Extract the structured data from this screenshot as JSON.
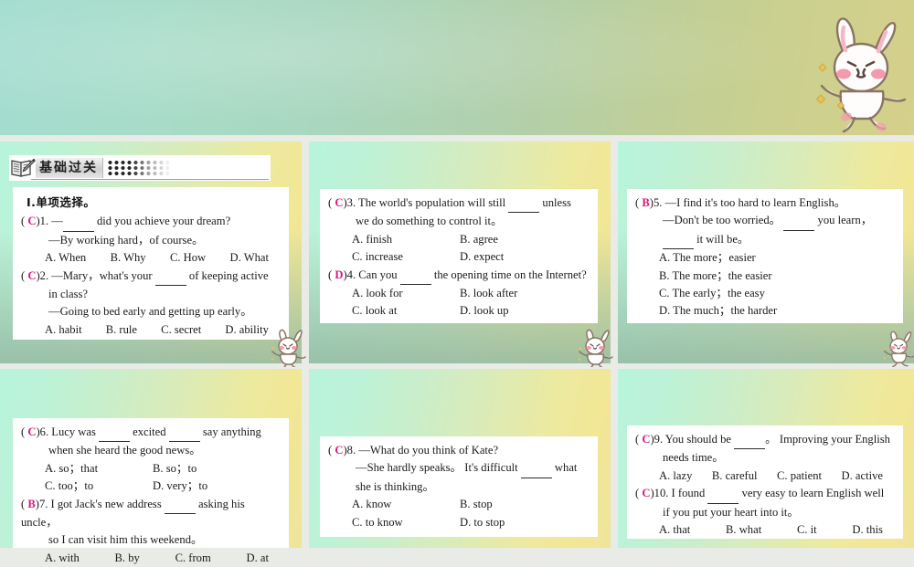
{
  "header": {
    "section_label": "基础过关",
    "book_icon": "open-book-with-pen-icon"
  },
  "subtitle": "Ⅰ.单项选择。",
  "mascot": "cartoon-rabbit-mascot",
  "colors": {
    "answer_pink": "#d6197d",
    "banner_teal": "#a3ddd0",
    "banner_olive": "#d5d08b",
    "card_white": "#ffffff",
    "slide_mint": "#b7f4dd",
    "slide_yellow": "#f2e795"
  },
  "questions": [
    {
      "number": "1.",
      "answer": "C",
      "mark_open": "(",
      "mark_close": ")",
      "lines": [
        {
          "indent": 0,
          "text": "—______ did you achieve your dream?"
        },
        {
          "indent": 1,
          "text": "—By working hard，of course。"
        }
      ],
      "options_layout": "row4",
      "options": [
        "A. When",
        "B. Why",
        "C. How",
        "D. What"
      ]
    },
    {
      "number": "2.",
      "answer": "C",
      "mark_open": "(",
      "mark_close": ")",
      "lines": [
        {
          "indent": 0,
          "text": "—Mary，what's your ______ of keeping active"
        },
        {
          "indent": 1,
          "text": "in class?"
        },
        {
          "indent": 1,
          "text": "—Going to bed early and getting up early。"
        }
      ],
      "options_layout": "row4",
      "options": [
        "A. habit",
        "B. rule",
        "C. secret",
        "D. ability"
      ]
    },
    {
      "number": "3.",
      "answer": "C",
      "mark_open": "(",
      "mark_close": ")",
      "lines": [
        {
          "indent": 0,
          "text": "The world's population will still ______ unless"
        },
        {
          "indent": 1,
          "text": "we do something to control it。"
        }
      ],
      "options_layout": "grid2",
      "options": [
        "A. finish",
        "B. agree",
        "C. increase",
        "D. expect"
      ]
    },
    {
      "number": "4.",
      "answer": "D",
      "mark_open": "(",
      "mark_close": ")",
      "lines": [
        {
          "indent": 0,
          "text": "Can you ______ the opening time on the Internet?"
        }
      ],
      "options_layout": "grid2",
      "options": [
        "A. look for",
        "B. look after",
        "C. look at",
        "D. look up"
      ]
    },
    {
      "number": "5.",
      "answer": "B",
      "mark_open": "(",
      "mark_close": ")",
      "lines": [
        {
          "indent": 0,
          "text": "—I find it's too hard to learn English。"
        },
        {
          "indent": 1,
          "text": "—Don't be too worried。 ______ you learn，"
        },
        {
          "indent": 1,
          "text": "______ it will be。"
        }
      ],
      "options_layout": "stack",
      "options": [
        "A. The more；easier",
        "B. The more；the easier",
        "C. The early；the easy",
        "D. The much；the harder"
      ]
    },
    {
      "number": "6.",
      "answer": "C",
      "mark_open": "(",
      "mark_close": ")",
      "lines": [
        {
          "indent": 0,
          "text": "Lucy was ______ excited ______ say anything"
        },
        {
          "indent": 1,
          "text": "when she heard the good news。"
        }
      ],
      "options_layout": "grid2",
      "options": [
        "A. so；that",
        "B. so；to",
        "C. too；to",
        "D. very；to"
      ]
    },
    {
      "number": "7.",
      "answer": "B",
      "mark_open": "(",
      "mark_close": ")",
      "lines": [
        {
          "indent": 0,
          "text": "I got Jack's new address ______ asking his uncle，"
        },
        {
          "indent": 1,
          "text": "so I can visit him this weekend。"
        }
      ],
      "options_layout": "row4",
      "options": [
        "A. with",
        "B. by",
        "C. from",
        "D. at"
      ]
    },
    {
      "number": "8.",
      "answer": "C",
      "mark_open": "(",
      "mark_close": ")",
      "lines": [
        {
          "indent": 0,
          "text": "—What do you think of Kate?"
        },
        {
          "indent": 1,
          "text": "—She hardly speaks。 It's difficult ______ what"
        },
        {
          "indent": 1,
          "text": "she is thinking。"
        }
      ],
      "options_layout": "grid2",
      "options": [
        "A. know",
        "B. stop",
        "C. to know",
        "D. to stop"
      ]
    },
    {
      "number": "9.",
      "answer": "C",
      "mark_open": "(",
      "mark_close": ")",
      "lines": [
        {
          "indent": 0,
          "text": "You should be ______。 Improving your English"
        },
        {
          "indent": 1,
          "text": "needs time。"
        }
      ],
      "options_layout": "row4",
      "options": [
        "A. lazy",
        "B. careful",
        "C. patient",
        "D. active"
      ]
    },
    {
      "number": "10.",
      "answer": "C",
      "mark_open": "(",
      "mark_close": ")",
      "lines": [
        {
          "indent": 0,
          "text": "I found ______ very easy to learn English well"
        },
        {
          "indent": 1,
          "text": "if you put your heart into it。"
        }
      ],
      "options_layout": "row4",
      "options": [
        "A. that",
        "B. what",
        "C. it",
        "D. this"
      ]
    }
  ],
  "slides": [
    {
      "id": "slide-1",
      "questions": [
        0,
        1
      ],
      "has_heading": true
    },
    {
      "id": "slide-2",
      "questions": [
        2,
        3
      ],
      "has_heading": false
    },
    {
      "id": "slide-3",
      "questions": [
        4
      ],
      "has_heading": false
    },
    {
      "id": "slide-4",
      "questions": [
        5,
        6
      ],
      "has_heading": false
    },
    {
      "id": "slide-5",
      "questions": [
        7
      ],
      "has_heading": false
    },
    {
      "id": "slide-6",
      "questions": [
        8,
        9
      ],
      "has_heading": false
    }
  ]
}
